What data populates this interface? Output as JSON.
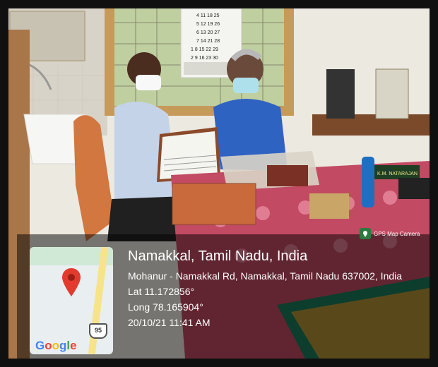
{
  "gps_overlay": {
    "badge_label": "GPS Map Camera",
    "place_title": "Namakkal, Tamil Nadu, India",
    "address": "Mohanur - Namakkal Rd, Namakkal, Tamil Nadu 637002, India",
    "latitude": "Lat 11.172856°",
    "longitude": "Long 78.165904°",
    "timestamp": "20/10/21 11:41 AM"
  },
  "map_thumbnail": {
    "route_shield": "95",
    "logo_text": "Google"
  },
  "scene": {
    "calendar_numbers": [
      "4 11 18 25",
      "5 12 19 26",
      "6 13 20 27",
      "7 14 21 28",
      "1 8 15 22 29",
      "2 9 16 23 30"
    ],
    "nameplate": "K.M. NATARAJAN"
  }
}
